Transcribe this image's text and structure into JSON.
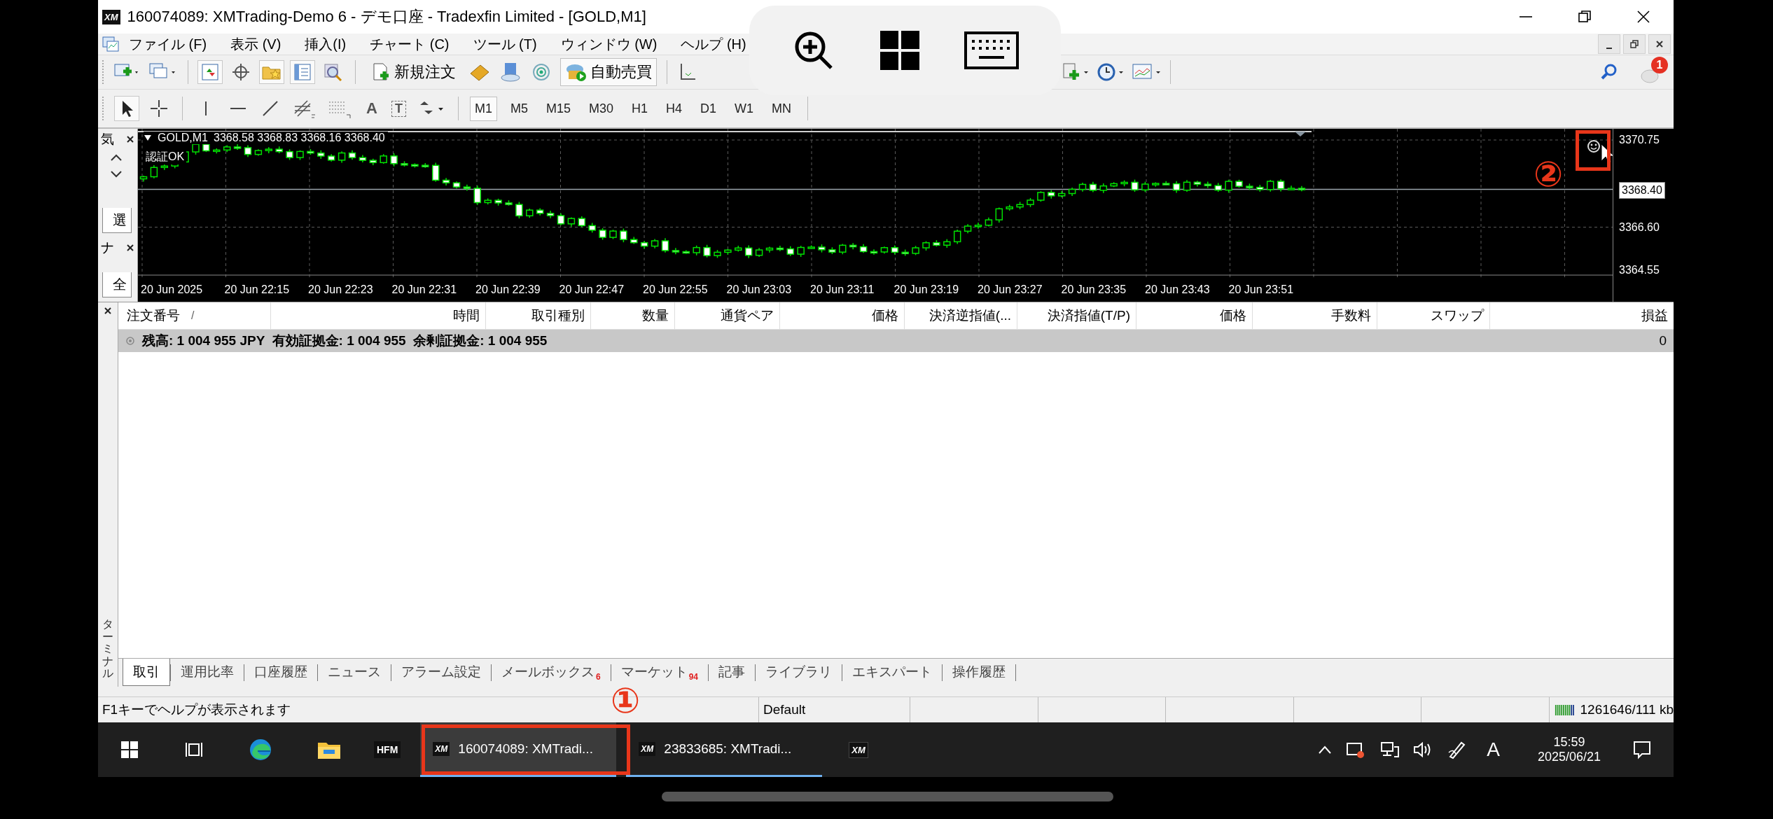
{
  "window": {
    "logo": "XM",
    "title": "160074089: XMTrading-Demo 6 - デモ口座 - Tradexfin Limited - [GOLD,M1]"
  },
  "menu": [
    {
      "label": "ファイル (F)"
    },
    {
      "label": "表示 (V)"
    },
    {
      "label": "挿入(I)"
    },
    {
      "label": "チャート (C)"
    },
    {
      "label": "ツール (T)"
    },
    {
      "label": "ウィンドウ (W)"
    },
    {
      "label": "ヘルプ (H)"
    }
  ],
  "toolbar": {
    "order_button": {
      "label": "新規注文"
    },
    "autotrade_button": {
      "label": "自動売買",
      "on": true
    },
    "notification_count": "1"
  },
  "drawing_tools": {
    "text_tool": "A",
    "label_tool": "T"
  },
  "timeframes": [
    {
      "label": "M1",
      "selected": true
    },
    {
      "label": "M5",
      "selected": false
    },
    {
      "label": "M15",
      "selected": false
    },
    {
      "label": "M30",
      "selected": false
    },
    {
      "label": "H1",
      "selected": false
    },
    {
      "label": "H4",
      "selected": false
    },
    {
      "label": "D1",
      "selected": false
    },
    {
      "label": "W1",
      "selected": false
    },
    {
      "label": "MN",
      "selected": false
    }
  ],
  "side_panels": [
    {
      "kind": "scroll",
      "title": "気",
      "tab": "選"
    },
    {
      "kind": "plain",
      "title": "ナ",
      "tab": "全"
    }
  ],
  "chart": {
    "symbol": "GOLD,M1",
    "ohlc": "3368.58 3368.83 3368.16 3368.40",
    "status": "認証OK",
    "price_labels": [
      {
        "kind": "tick",
        "label": "3370.75"
      },
      {
        "kind": "current",
        "label": "3368.40"
      },
      {
        "kind": "tick",
        "label": "3366.60"
      },
      {
        "kind": "tick",
        "label": "3364.55"
      }
    ],
    "time_labels": [
      "20 Jun 2025",
      "20 Jun 22:15",
      "20 Jun 22:23",
      "20 Jun 22:31",
      "20 Jun 22:39",
      "20 Jun 22:47",
      "20 Jun 22:55",
      "20 Jun 23:03",
      "20 Jun 23:11",
      "20 Jun 23:19",
      "20 Jun 23:27",
      "20 Jun 23:35",
      "20 Jun 23:43",
      "20 Jun 23:51"
    ]
  },
  "terminal": {
    "label": "ターミナル",
    "sort_mark": "/",
    "columns": [
      "注文番号",
      "時間",
      "取引種別",
      "数量",
      "通貨ペア",
      "価格",
      "決済逆指値(...",
      "決済指値(T/P)",
      "価格",
      "手数料",
      "スワップ",
      "損益"
    ],
    "summary_row": {
      "text": "残高: 1 004 955 JPY  有効証拠金: 1 004 955  余剰証拠金: 1 004 955",
      "profit": "0"
    },
    "tabs": [
      {
        "label": "取引",
        "selected": true
      },
      {
        "label": "運用比率",
        "selected": false
      },
      {
        "label": "口座履歴",
        "selected": false
      },
      {
        "label": "ニュース",
        "selected": false
      },
      {
        "label": "アラーム設定",
        "selected": false
      },
      {
        "label": "メールボックス",
        "badge": "6",
        "selected": false
      },
      {
        "label": "マーケット",
        "badge": "94",
        "selected": false
      },
      {
        "label": "記事",
        "selected": false
      },
      {
        "label": "ライブラリ",
        "selected": false
      },
      {
        "label": "エキスパート",
        "selected": false
      },
      {
        "label": "操作履歴",
        "selected": false
      }
    ]
  },
  "status_bar": {
    "help": "F1キーでヘルプが表示されます",
    "profile": "Default",
    "traffic": "1261646/111 kb"
  },
  "taskbar": {
    "hfm_logo": "HFM",
    "windows": [
      {
        "logo": "XM",
        "label": "160074089: XMTradi...",
        "selected": true
      },
      {
        "logo": "XM",
        "label": "23833685: XMTradi...",
        "selected": false
      }
    ],
    "pinned_logo": "XM",
    "ime": "A",
    "time": "15:59",
    "date": "2025/06/21"
  },
  "annotations": [
    {
      "label": "①"
    },
    {
      "label": "②"
    }
  ]
}
